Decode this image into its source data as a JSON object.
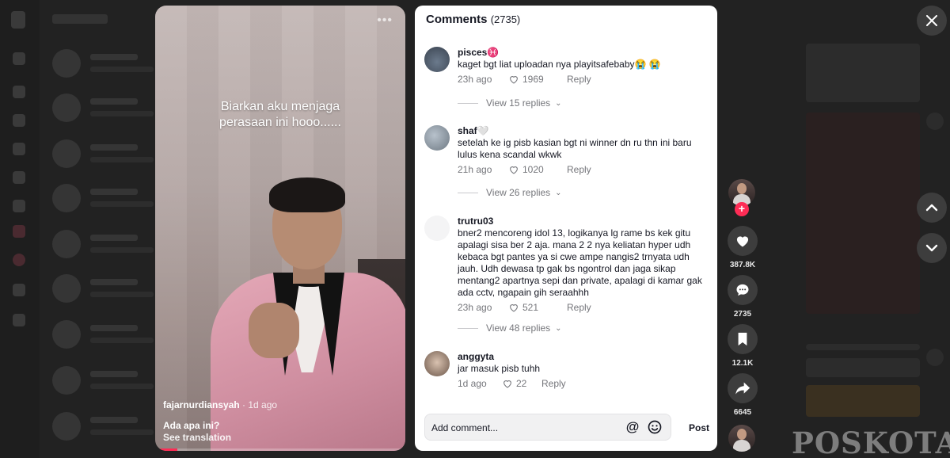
{
  "video": {
    "overlay_text_line1": "Biarkan aku menjaga",
    "overlay_text_line2": "perasaan ini hooo......",
    "author": "fajarnurdiansyah",
    "separator": " · ",
    "posted": "1d ago",
    "caption": "Ada apa ini?",
    "see_translation": "See translation",
    "progress": 0.09
  },
  "comments_panel": {
    "title": "Comments",
    "count": "(2735)",
    "comments": [
      {
        "user": "pisces♓",
        "text": "kaget bgt liat uploadan nya playitsafebaby😭 😭",
        "time": "23h ago",
        "likes": "1969",
        "reply": "Reply",
        "view_replies": "View 15 replies"
      },
      {
        "user": "shaf🤍",
        "text": "setelah ke ig pisb kasian bgt ni winner dn ru thn ini baru lulus kena scandal wkwk",
        "time": "21h ago",
        "likes": "1020",
        "reply": "Reply",
        "view_replies": "View 26 replies"
      },
      {
        "user": "trutru03",
        "text": "bner2 mencoreng idol 13, logikanya lg rame bs kek gitu apalagi sisa ber 2 aja. mana 2 2 nya keliatan hyper udh kebaca bgt pantes ya si cwe ampe nangis2 trnyata udh jauh. Udh dewasa tp gak bs ngontrol dan jaga sikap mentang2 apartnya sepi dan private, apalagi di kamar gak ada cctv, ngapain gih seraahhh",
        "time": "23h ago",
        "likes": "521",
        "reply": "Reply",
        "view_replies": "View 48 replies"
      },
      {
        "user": "anggyta",
        "text": "jar masuk pisb tuhh",
        "time": "1d ago",
        "likes": "22",
        "reply": "Reply"
      }
    ],
    "input_placeholder": "Add comment...",
    "mention_icon": "@",
    "post_label": "Post"
  },
  "rail": {
    "likes": "387.8K",
    "comments": "2735",
    "saves": "12.1K",
    "shares": "6645",
    "follow_symbol": "+"
  },
  "watermark": "POSKOTA",
  "colors": {
    "accent": "#fe2c55",
    "panel_bg": "#ffffff",
    "overlay_bg": "#1c1c1c",
    "muted_text": "#75767b"
  }
}
